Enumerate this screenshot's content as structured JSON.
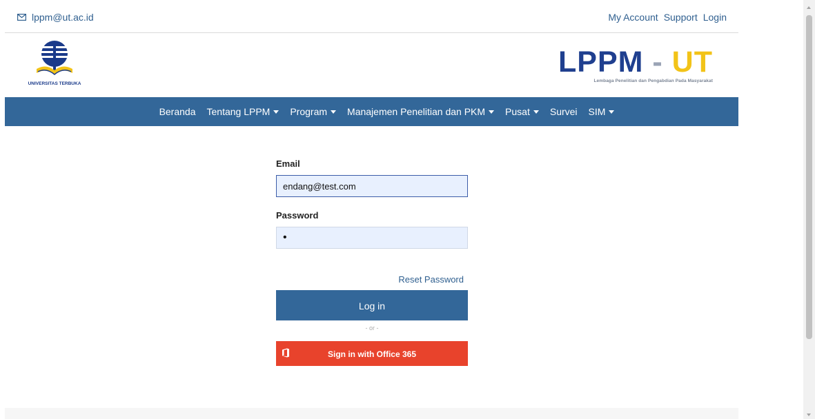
{
  "topbar": {
    "email": "lppm@ut.ac.id",
    "links": [
      "My Account",
      "Support",
      "Login"
    ]
  },
  "header": {
    "ut_logo_text": "UNIVERSITAS TERBUKA",
    "brand_lppm": "LPPM",
    "brand_dash": " - ",
    "brand_ut": "UT",
    "tagline": "Lembaga Penelitian dan Pengabdian Pada Masyarakat"
  },
  "nav": {
    "items": [
      {
        "label": "Beranda",
        "dropdown": false
      },
      {
        "label": "Tentang LPPM",
        "dropdown": true
      },
      {
        "label": "Program",
        "dropdown": true
      },
      {
        "label": "Manajemen Penelitian dan PKM",
        "dropdown": true
      },
      {
        "label": "Pusat",
        "dropdown": true
      },
      {
        "label": "Survei",
        "dropdown": false
      },
      {
        "label": "SIM",
        "dropdown": true
      }
    ]
  },
  "form": {
    "email_label": "Email",
    "email_value": "endang@test.com",
    "password_label": "Password",
    "password_value": "•",
    "reset_label": "Reset Password",
    "login_label": "Log in",
    "or_text": "- or -",
    "office_label": "Sign in with Office 365"
  },
  "colors": {
    "primary": "#336799",
    "office": "#e8432c",
    "brand_blue": "#1f3f8f",
    "brand_yellow": "#f2c318",
    "input_bg": "#e8f0fe"
  }
}
